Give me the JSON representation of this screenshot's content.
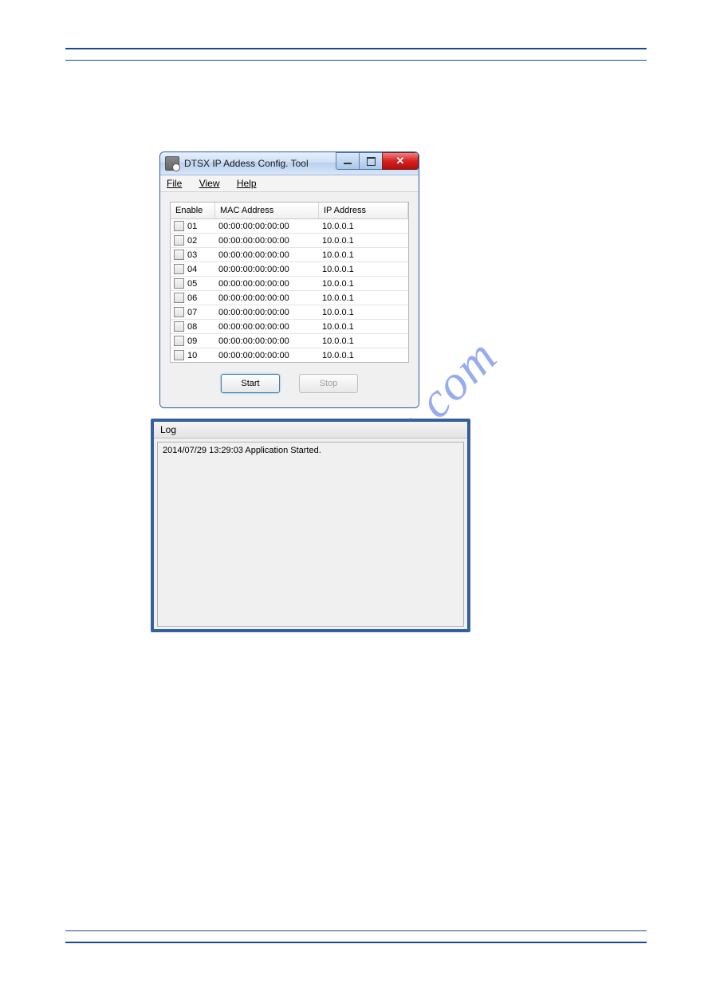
{
  "watermark": "manualshive.com",
  "mainWindow": {
    "title": "DTSX IP Addess Config. Tool",
    "menu": {
      "file": "File",
      "view": "View",
      "help": "Help"
    },
    "columns": {
      "enable": "Enable",
      "mac": "MAC Address",
      "ip": "IP Address"
    },
    "rows": [
      {
        "num": "01",
        "mac": "00:00:00:00:00:00",
        "ip": "10.0.0.1"
      },
      {
        "num": "02",
        "mac": "00:00:00:00:00:00",
        "ip": "10.0.0.1"
      },
      {
        "num": "03",
        "mac": "00:00:00:00:00:00",
        "ip": "10.0.0.1"
      },
      {
        "num": "04",
        "mac": "00:00:00:00:00:00",
        "ip": "10.0.0.1"
      },
      {
        "num": "05",
        "mac": "00:00:00:00:00:00",
        "ip": "10.0.0.1"
      },
      {
        "num": "06",
        "mac": "00:00:00:00:00:00",
        "ip": "10.0.0.1"
      },
      {
        "num": "07",
        "mac": "00:00:00:00:00:00",
        "ip": "10.0.0.1"
      },
      {
        "num": "08",
        "mac": "00:00:00:00:00:00",
        "ip": "10.0.0.1"
      },
      {
        "num": "09",
        "mac": "00:00:00:00:00:00",
        "ip": "10.0.0.1"
      },
      {
        "num": "10",
        "mac": "00:00:00:00:00:00",
        "ip": "10.0.0.1"
      }
    ],
    "buttons": {
      "start": "Start",
      "stop": "Stop"
    }
  },
  "logWindow": {
    "title": "Log",
    "entry": "2014/07/29 13:29:03 Application Started."
  }
}
